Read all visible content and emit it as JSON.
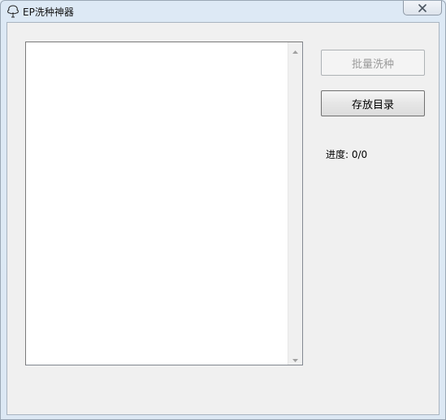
{
  "window": {
    "title": "EP洗种神器",
    "close_icon": "close-x-icon",
    "app_icon": "tree-icon"
  },
  "list": {
    "items": []
  },
  "buttons": {
    "batch_wash": {
      "label": "批量洗种",
      "enabled": false
    },
    "storage_dir": {
      "label": "存放目录",
      "enabled": true
    }
  },
  "progress": {
    "text": "进度: 0/0"
  },
  "colors": {
    "client_bg": "#f0f0f0",
    "disabled_text": "#9a9a9a"
  }
}
